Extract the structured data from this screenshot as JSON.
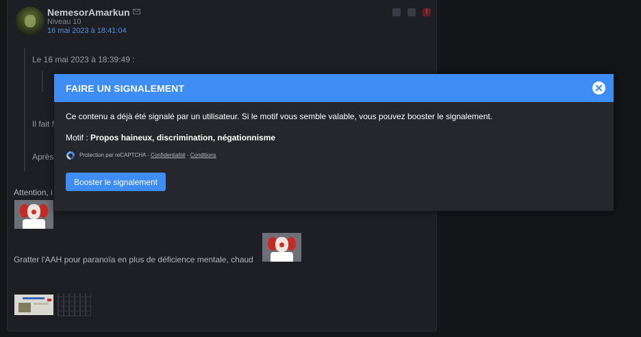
{
  "post": {
    "username": "NemesorAmarkun",
    "level": "Niveau 10",
    "date": "16 mai 2023 à 18:41:04",
    "report_icon_symbol": "!",
    "quote_header": "Le 16 mai 2023 à 18:39:49 :",
    "quote_line1": "Il fait f",
    "quote_line2": "Après",
    "text1": "Attention, i",
    "text2": "Gratter l'AAH pour paranoïa en plus de déficience mentale, chaud"
  },
  "modal": {
    "title": "FAIRE UN SIGNALEMENT",
    "message": "Ce contenu a déjà été signalé par un utilisateur. Si le motif vous semble valable, vous pouvez booster le signalement.",
    "motif_label": "Motif :",
    "motif_value": "Propos haineux, discrimination, négationnisme",
    "recaptcha_prefix": "Protection par reCAPTCHA - ",
    "recaptcha_privacy": "Confidentialité",
    "recaptcha_sep": " - ",
    "recaptcha_terms": "Conditions",
    "boost_button": "Booster le signalement"
  },
  "colors": {
    "accent": "#3d8df5",
    "background": "#141518",
    "modal_body": "#25272c",
    "link": "#4e91e0"
  }
}
